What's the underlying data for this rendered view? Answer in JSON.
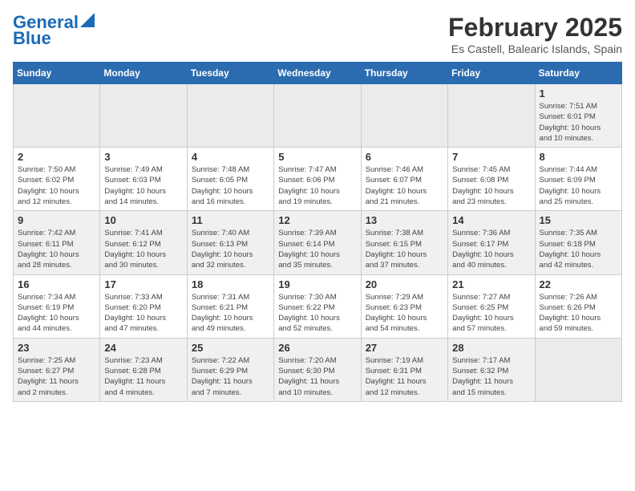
{
  "logo": {
    "line1": "General",
    "line2": "Blue"
  },
  "title": "February 2025",
  "location": "Es Castell, Balearic Islands, Spain",
  "weekdays": [
    "Sunday",
    "Monday",
    "Tuesday",
    "Wednesday",
    "Thursday",
    "Friday",
    "Saturday"
  ],
  "weeks": [
    [
      {
        "day": "",
        "info": ""
      },
      {
        "day": "",
        "info": ""
      },
      {
        "day": "",
        "info": ""
      },
      {
        "day": "",
        "info": ""
      },
      {
        "day": "",
        "info": ""
      },
      {
        "day": "",
        "info": ""
      },
      {
        "day": "1",
        "info": "Sunrise: 7:51 AM\nSunset: 6:01 PM\nDaylight: 10 hours\nand 10 minutes."
      }
    ],
    [
      {
        "day": "2",
        "info": "Sunrise: 7:50 AM\nSunset: 6:02 PM\nDaylight: 10 hours\nand 12 minutes."
      },
      {
        "day": "3",
        "info": "Sunrise: 7:49 AM\nSunset: 6:03 PM\nDaylight: 10 hours\nand 14 minutes."
      },
      {
        "day": "4",
        "info": "Sunrise: 7:48 AM\nSunset: 6:05 PM\nDaylight: 10 hours\nand 16 minutes."
      },
      {
        "day": "5",
        "info": "Sunrise: 7:47 AM\nSunset: 6:06 PM\nDaylight: 10 hours\nand 19 minutes."
      },
      {
        "day": "6",
        "info": "Sunrise: 7:46 AM\nSunset: 6:07 PM\nDaylight: 10 hours\nand 21 minutes."
      },
      {
        "day": "7",
        "info": "Sunrise: 7:45 AM\nSunset: 6:08 PM\nDaylight: 10 hours\nand 23 minutes."
      },
      {
        "day": "8",
        "info": "Sunrise: 7:44 AM\nSunset: 6:09 PM\nDaylight: 10 hours\nand 25 minutes."
      }
    ],
    [
      {
        "day": "9",
        "info": "Sunrise: 7:42 AM\nSunset: 6:11 PM\nDaylight: 10 hours\nand 28 minutes."
      },
      {
        "day": "10",
        "info": "Sunrise: 7:41 AM\nSunset: 6:12 PM\nDaylight: 10 hours\nand 30 minutes."
      },
      {
        "day": "11",
        "info": "Sunrise: 7:40 AM\nSunset: 6:13 PM\nDaylight: 10 hours\nand 32 minutes."
      },
      {
        "day": "12",
        "info": "Sunrise: 7:39 AM\nSunset: 6:14 PM\nDaylight: 10 hours\nand 35 minutes."
      },
      {
        "day": "13",
        "info": "Sunrise: 7:38 AM\nSunset: 6:15 PM\nDaylight: 10 hours\nand 37 minutes."
      },
      {
        "day": "14",
        "info": "Sunrise: 7:36 AM\nSunset: 6:17 PM\nDaylight: 10 hours\nand 40 minutes."
      },
      {
        "day": "15",
        "info": "Sunrise: 7:35 AM\nSunset: 6:18 PM\nDaylight: 10 hours\nand 42 minutes."
      }
    ],
    [
      {
        "day": "16",
        "info": "Sunrise: 7:34 AM\nSunset: 6:19 PM\nDaylight: 10 hours\nand 44 minutes."
      },
      {
        "day": "17",
        "info": "Sunrise: 7:33 AM\nSunset: 6:20 PM\nDaylight: 10 hours\nand 47 minutes."
      },
      {
        "day": "18",
        "info": "Sunrise: 7:31 AM\nSunset: 6:21 PM\nDaylight: 10 hours\nand 49 minutes."
      },
      {
        "day": "19",
        "info": "Sunrise: 7:30 AM\nSunset: 6:22 PM\nDaylight: 10 hours\nand 52 minutes."
      },
      {
        "day": "20",
        "info": "Sunrise: 7:29 AM\nSunset: 6:23 PM\nDaylight: 10 hours\nand 54 minutes."
      },
      {
        "day": "21",
        "info": "Sunrise: 7:27 AM\nSunset: 6:25 PM\nDaylight: 10 hours\nand 57 minutes."
      },
      {
        "day": "22",
        "info": "Sunrise: 7:26 AM\nSunset: 6:26 PM\nDaylight: 10 hours\nand 59 minutes."
      }
    ],
    [
      {
        "day": "23",
        "info": "Sunrise: 7:25 AM\nSunset: 6:27 PM\nDaylight: 11 hours\nand 2 minutes."
      },
      {
        "day": "24",
        "info": "Sunrise: 7:23 AM\nSunset: 6:28 PM\nDaylight: 11 hours\nand 4 minutes."
      },
      {
        "day": "25",
        "info": "Sunrise: 7:22 AM\nSunset: 6:29 PM\nDaylight: 11 hours\nand 7 minutes."
      },
      {
        "day": "26",
        "info": "Sunrise: 7:20 AM\nSunset: 6:30 PM\nDaylight: 11 hours\nand 10 minutes."
      },
      {
        "day": "27",
        "info": "Sunrise: 7:19 AM\nSunset: 6:31 PM\nDaylight: 11 hours\nand 12 minutes."
      },
      {
        "day": "28",
        "info": "Sunrise: 7:17 AM\nSunset: 6:32 PM\nDaylight: 11 hours\nand 15 minutes."
      },
      {
        "day": "",
        "info": ""
      }
    ]
  ]
}
